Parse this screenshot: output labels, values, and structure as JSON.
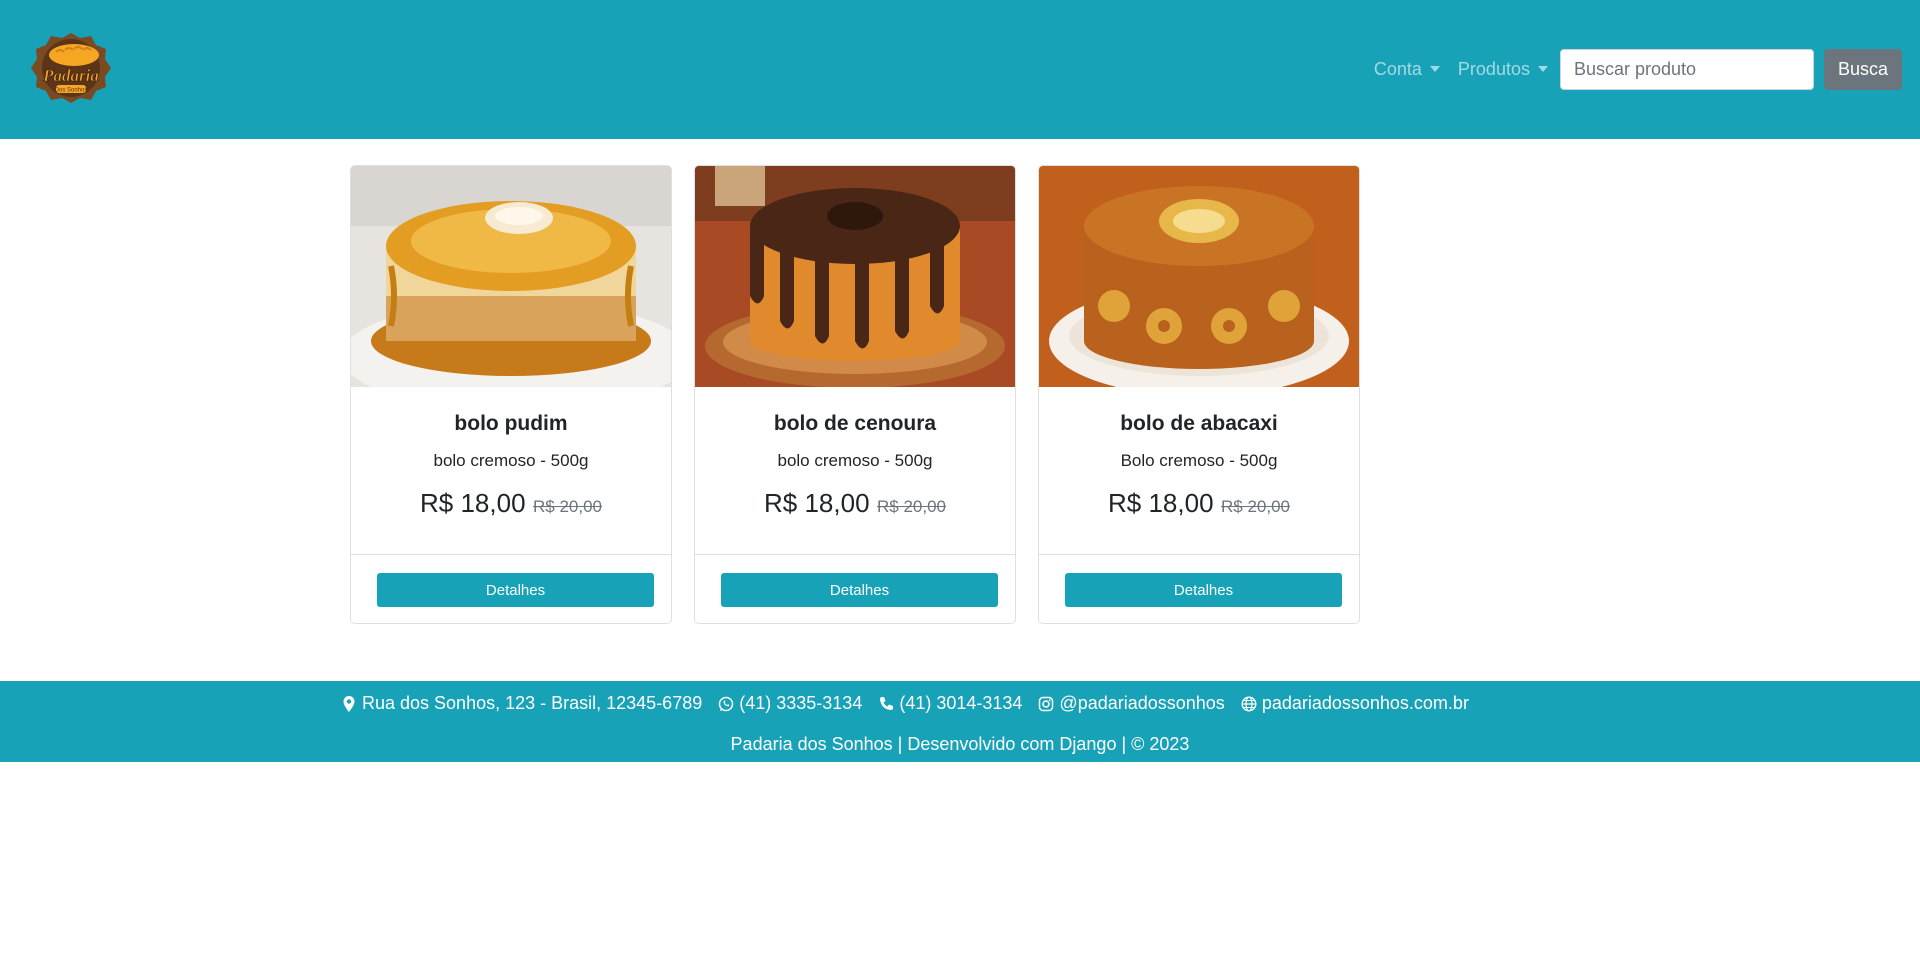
{
  "navbar": {
    "logo_text": "Padaria",
    "logo_subtext": "Dos Sonhos",
    "menu": [
      {
        "label": "Conta"
      },
      {
        "label": "Produtos"
      }
    ],
    "search": {
      "placeholder": "Buscar produto",
      "value": "",
      "button_label": "Busca"
    },
    "bg_color": "#17a2b8"
  },
  "products": [
    {
      "name": "bolo pudim",
      "description": "bolo cremoso - 500g",
      "price": "R$ 18,00",
      "old_price": "R$ 20,00",
      "button_label": "Detalhes"
    },
    {
      "name": "bolo de cenoura",
      "description": "bolo cremoso - 500g",
      "price": "R$ 18,00",
      "old_price": "R$ 20,00",
      "button_label": "Detalhes"
    },
    {
      "name": "bolo de abacaxi",
      "description": "Bolo cremoso - 500g",
      "price": "R$ 18,00",
      "old_price": "R$ 20,00",
      "button_label": "Detalhes"
    }
  ],
  "footer": {
    "address": "Rua dos Sonhos, 123 - Brasil, 12345-6789",
    "whatsapp": "(41) 3335-3134",
    "phone": "(41) 3014-3134",
    "instagram": "@padariadossonhos",
    "website": "padariadossonhos.com.br",
    "copyright": "Padaria dos Sonhos | Desenvolvido com Django | © 2023",
    "icons": [
      "map-marker-icon",
      "whatsapp-icon",
      "phone-icon",
      "instagram-icon",
      "globe-icon"
    ]
  }
}
